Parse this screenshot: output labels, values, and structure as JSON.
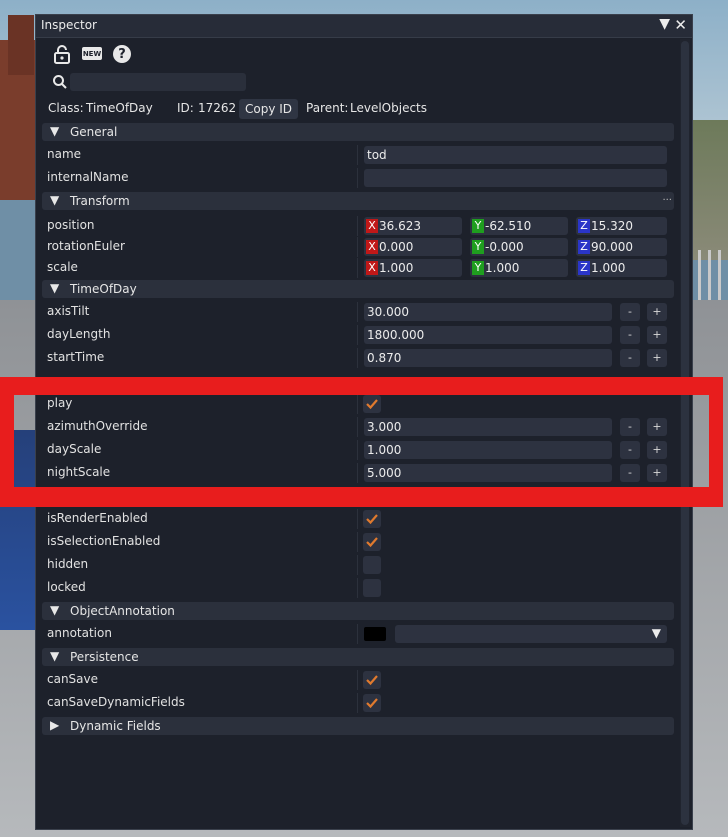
{
  "window": {
    "title": "Inspector",
    "collapse_glyph": "▼",
    "close_glyph": "✕"
  },
  "toolbar": {
    "icons": [
      "lock-icon",
      "new-icon",
      "help-icon"
    ],
    "new_text": "NEW",
    "help_text": "?"
  },
  "search": {
    "value": "",
    "placeholder": ""
  },
  "info": {
    "class_label": "Class:",
    "class_value": "TimeOfDay",
    "id_label": "ID:",
    "id_value": "17262",
    "copy_id": "Copy ID",
    "parent_label": "Parent:",
    "parent_value": "LevelObjects"
  },
  "sections": {
    "general": "General",
    "transform": "Transform",
    "timeofday": "TimeOfDay",
    "objectannotation": "ObjectAnnotation",
    "persistence": "Persistence",
    "dynamic": "Dynamic Fields",
    "more": "..."
  },
  "general": {
    "name_label": "name",
    "name_value": "tod",
    "internal_label": "internalName",
    "internal_value": ""
  },
  "transform": {
    "axis_x": "X",
    "axis_y": "Y",
    "axis_z": "Z",
    "position_label": "position",
    "position": [
      "36.623",
      "-62.510",
      "15.320"
    ],
    "rotation_label": "rotationEuler",
    "rotation": [
      "0.000",
      "-0.000",
      "90.000"
    ],
    "scale_label": "scale",
    "scale": [
      "1.000",
      "1.000",
      "1.000"
    ]
  },
  "tod": {
    "minus": "-",
    "plus": "+",
    "axisTilt_label": "axisTilt",
    "axisTilt": "30.000",
    "dayLength_label": "dayLength",
    "dayLength": "1800.000",
    "startTime_label": "startTime",
    "startTime": "0.870",
    "play_label": "play",
    "play": true,
    "azimuth_label": "azimuthOverride",
    "azimuth": "3.000",
    "dayScale_label": "dayScale",
    "dayScale": "1.000",
    "nightScale_label": "nightScale",
    "nightScale": "5.000"
  },
  "render": {
    "isRenderEnabled_label": "isRenderEnabled",
    "isRenderEnabled": true,
    "isSelectionEnabled_label": "isSelectionEnabled",
    "isSelectionEnabled": true,
    "hidden_label": "hidden",
    "hidden": false,
    "locked_label": "locked",
    "locked": false
  },
  "annotation": {
    "label": "annotation",
    "color": "#000000",
    "value": "",
    "caret": "▼"
  },
  "persistence": {
    "canSave_label": "canSave",
    "canSave": true,
    "canSaveDynamic_label": "canSaveDynamicFields",
    "canSaveDynamic": true
  },
  "glyphs": {
    "expanded": "▼",
    "collapsed": "▶"
  },
  "colors": {
    "accent_check": "#e07a2e",
    "highlight": "#e81d1d",
    "x": "#c01818",
    "y": "#1f9e1f",
    "z": "#2a35c8"
  }
}
